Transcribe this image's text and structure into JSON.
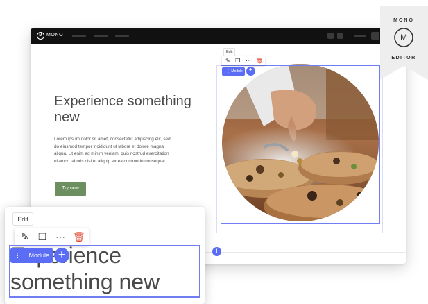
{
  "brand": {
    "logo_mark": "M",
    "name": "MONO"
  },
  "hero": {
    "title": "Experience something new",
    "body": "Lorem ipsum dolor sit amet, consectetur adipiscing elit, sed do eiusmod tempor incididunt ut labore et dolore magna aliqua. Ut enim ad minim veniam, quis nostrud exercitation ullamco laboris nisi ut aliquip ex ea commodo consequat.",
    "cta": "Try now"
  },
  "editor": {
    "tooltip": "Edit",
    "module_label": "Module",
    "add_symbol": "+",
    "tools": [
      "edit-icon",
      "duplicate-icon",
      "more-icon",
      "delete-icon"
    ]
  },
  "badge": {
    "top": "MONO",
    "bottom": "EDITOR",
    "mark": "M"
  },
  "colors": {
    "accent": "#5b6cf5",
    "cta": "#6d8f5f",
    "delete": "#e0452b",
    "topbar": "#111111"
  }
}
